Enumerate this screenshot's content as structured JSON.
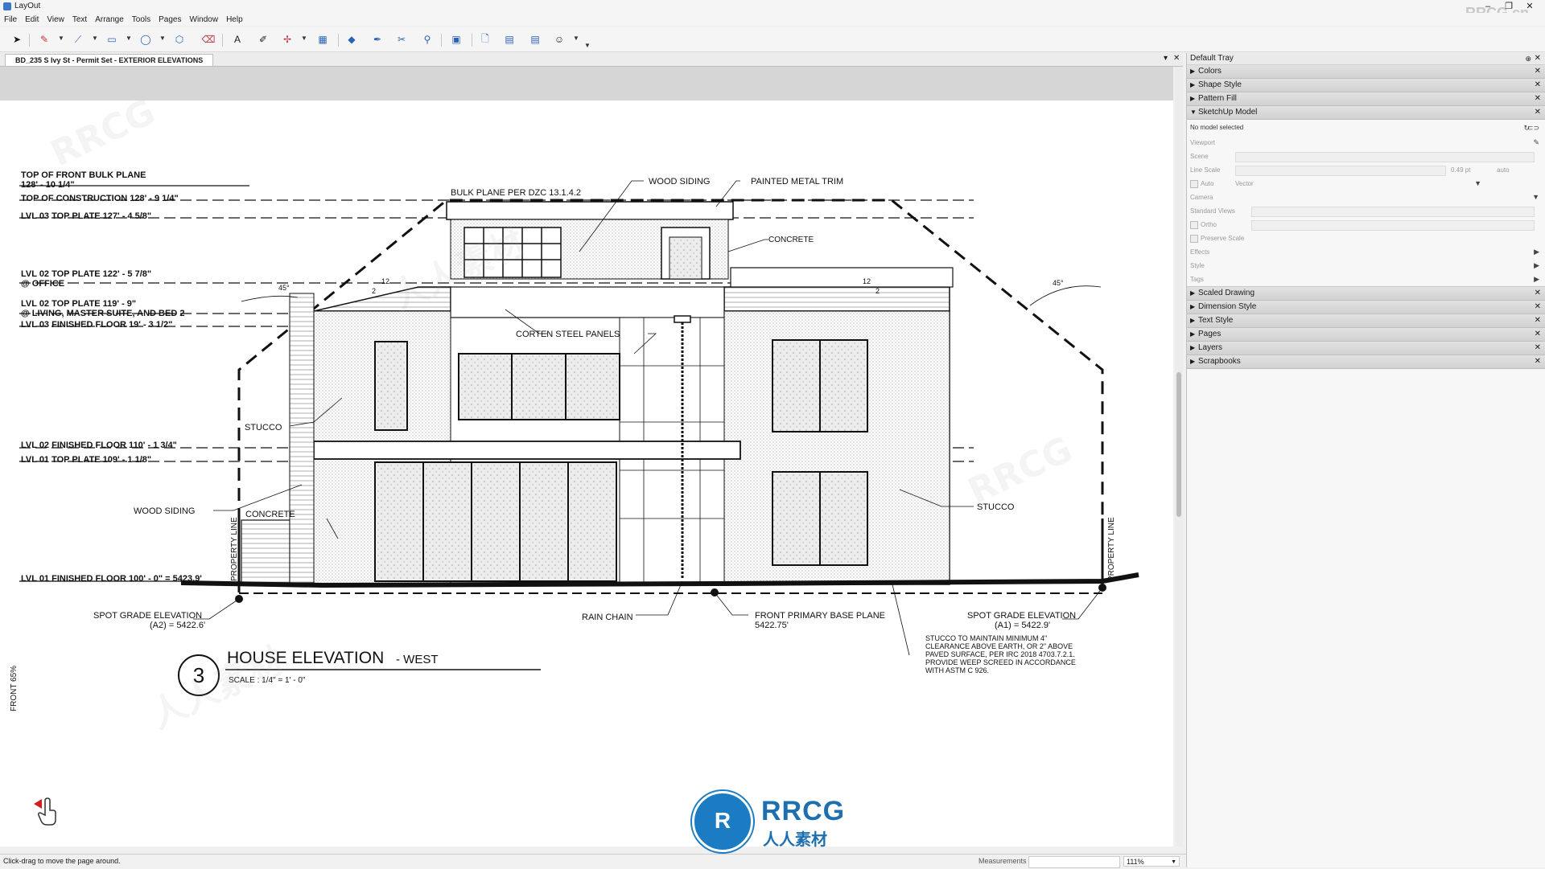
{
  "window": {
    "title": "LayOut",
    "watermark": "RRCG.cn"
  },
  "menu": [
    "File",
    "Edit",
    "View",
    "Text",
    "Arrange",
    "Tools",
    "Pages",
    "Window",
    "Help"
  ],
  "toolbar": {
    "icons": [
      "select-icon",
      "pencil-icon",
      "line-icon",
      "rectangle-icon",
      "circle-icon",
      "polygon-icon",
      "eraser-icon",
      "text-icon",
      "label-icon",
      "dimension-icon",
      "table-icon",
      "style-icon",
      "sample-icon",
      "split-icon",
      "join-icon",
      "presentation-icon",
      "add-page-icon",
      "previous-page-icon",
      "next-page-icon",
      "user-icon"
    ]
  },
  "document_tab": {
    "label": "BD_235 S Ivy St - Permit Set - EXTERIOR ELEVATIONS"
  },
  "drawing": {
    "levels": [
      "TOP OF FRONT BULK PLANE",
      "128' - 10 1/4\"",
      "TOP OF CONSTRUCTION  128' - 9 1/4\"",
      "LVL 03 TOP PLATE  127' - 4 5/8\"",
      "LVL 02 TOP PLATE  122' - 5 7/8\"",
      "@ OFFICE",
      "LVL 02 TOP PLATE  119' - 9\"",
      "@ LIVING, MASTER SUITE, AND BED 2",
      "LVL 03 FINISHED FLOOR  19' - 3 1/2\"",
      "LVL 02 FINISHED FLOOR  110' - 1 3/4\"",
      "LVL 01 TOP PLATE  109' - 1 1/8\"",
      "LVL 01 FINISHED FLOOR  100' - 0\" = 5423.9'"
    ],
    "callouts": {
      "bulk_plane": "BULK PLANE PER DZC 13.1.4.2",
      "wood_siding_top": "WOOD SIDING",
      "painted_metal_trim": "PAINTED METAL TRIM",
      "concrete_top": "CONCRETE",
      "corten": "CORTEN STEEL PANELS",
      "stucco_left": "STUCCO",
      "wood_siding_left": "WOOD SIDING",
      "concrete_left": "CONCRETE",
      "stucco_right": "STUCCO",
      "rain_chain": "RAIN CHAIN",
      "spot_grade_left_1": "SPOT GRADE ELEVATION",
      "spot_grade_left_2": "(A2) = 5422.6'",
      "spot_grade_right_1": "SPOT GRADE ELEVATION",
      "spot_grade_right_2": "(A1) = 5422.9'",
      "front_base_1": "FRONT PRIMARY BASE PLANE",
      "front_base_2": "5422.75'",
      "property_line": "PROPERTY LINE",
      "angle": "45°",
      "pitch_rise": "12",
      "pitch_run": "2"
    },
    "stucco_note": [
      "STUCCO TO MAINTAIN MINIMUM 4\"",
      "CLEARANCE ABOVE EARTH, OR 2\" ABOVE",
      "PAVED SURFACE, PER IRC 2018 4703.7.2.1.",
      "PROVIDE WEEP SCREED IN ACCORDANCE",
      "WITH ASTM C 926."
    ],
    "view_number": "3",
    "view_title": "HOUSE ELEVATION",
    "view_subtitle": "- WEST",
    "scale": "SCALE  :  1/4\" = 1' - 0\"",
    "side_label": "FRONT 65%"
  },
  "tray": {
    "title": "Default Tray",
    "panels_top": [
      "Colors",
      "Shape Style",
      "Pattern Fill"
    ],
    "sketchup_model": {
      "header": "SketchUp Model",
      "status": "No model selected",
      "viewport": "Viewport",
      "scene": "Scene",
      "line_scale": "Line Scale",
      "line_scale_value": "0.49 pt",
      "line_scale_mode": "auto",
      "auto": "Auto",
      "render_mode": "Vector",
      "camera": "Camera",
      "standard_views": "Standard Views",
      "ortho": "Ortho",
      "preserve_scale": "Preserve Scale",
      "effects": "Effects",
      "style": "Style",
      "tags": "Tags"
    },
    "panels_bottom": [
      "Scaled Drawing",
      "Dimension Style",
      "Text Style",
      "Pages",
      "Layers",
      "Scrapbooks"
    ]
  },
  "status": {
    "message": "Click-drag to move the page around.",
    "measurements_label": "Measurements",
    "zoom": "111%"
  },
  "logo": {
    "brand": "RRCG",
    "sub": "人人素材",
    "mark": "R"
  },
  "colors": {
    "accent": "#1b7cc4",
    "toolbar_red": "#c0303b",
    "toolbar_blue": "#2a62b8"
  }
}
